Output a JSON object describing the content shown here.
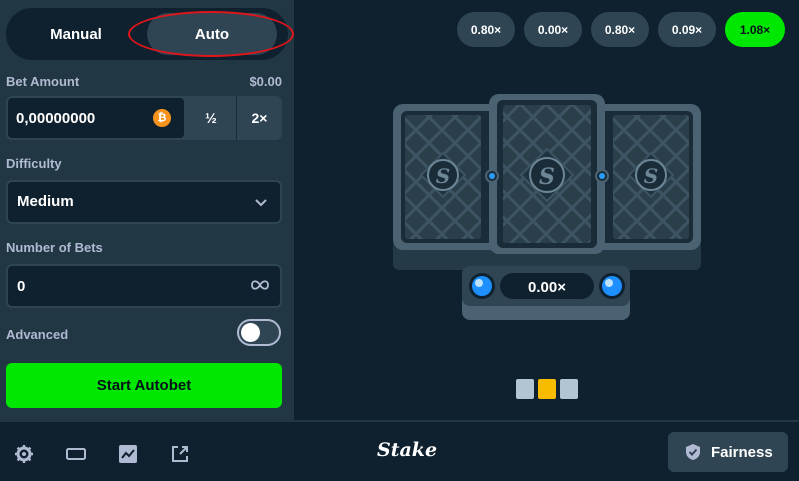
{
  "tabs": {
    "manual": "Manual",
    "auto": "Auto"
  },
  "bet": {
    "label": "Bet Amount",
    "usd": "$0.00",
    "value": "0,00000000",
    "currency_icon": "bitcoin-icon",
    "currency_symbol": "₿",
    "half": "½",
    "double": "2×"
  },
  "difficulty": {
    "label": "Difficulty",
    "selected": "Medium"
  },
  "num_bets": {
    "label": "Number of Bets",
    "value": "0",
    "icon": "infinity-icon"
  },
  "advanced": {
    "label": "Advanced",
    "enabled": false
  },
  "start_button": "Start Autobet",
  "history": [
    {
      "label": "0.80×",
      "win": false
    },
    {
      "label": "0.00×",
      "win": false
    },
    {
      "label": "0.80×",
      "win": false
    },
    {
      "label": "0.09×",
      "win": false
    },
    {
      "label": "1.08×",
      "win": true
    }
  ],
  "game": {
    "multiplier": "0.00×",
    "card_glyph": "S"
  },
  "progress_dots": [
    {
      "color": "#b1c5d3"
    },
    {
      "color": "#f7bb00"
    },
    {
      "color": "#b1c5d3"
    }
  ],
  "footer": {
    "icons": [
      "gear-icon",
      "theatre-mode-icon",
      "stats-icon",
      "popout-icon"
    ],
    "logo": "Stake",
    "fairness": "Fairness"
  },
  "colors": {
    "accent_green": "#00e701",
    "panel": "#213743",
    "background": "#0f212e",
    "highlight_ring": "#e0161b"
  }
}
